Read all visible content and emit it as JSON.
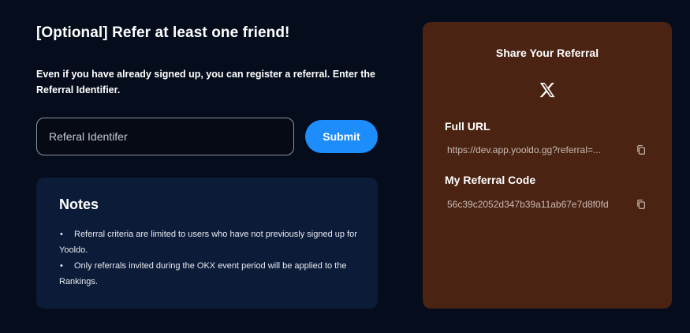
{
  "referral": {
    "title": "[Optional] Refer at least one friend!",
    "description": "Even if you have already signed up, you can register a referral.  Enter the Referral Identifier.",
    "input_placeholder": "Referal Identifer",
    "input_value": "",
    "submit_label": "Submit"
  },
  "notes": {
    "title": "Notes",
    "bullet": "•",
    "items": [
      "Referral criteria are limited to users who have not previously signed up for Yooldo.",
      "Only referrals invited during the OKX event period will be applied to the Rankings."
    ]
  },
  "share": {
    "title": "Share Your Referral",
    "x_glyph": "𝕏",
    "full_url_label": "Full URL",
    "full_url_value": "https://dev.app.yooldo.gg?referral=...",
    "code_label": "My Referral Code",
    "code_value": "56c39c2052d347b39a11ab67e7d8f0fd"
  },
  "colors": {
    "background": "#050d1c",
    "notes_panel": "#0b1b38",
    "share_panel": "#4b2312",
    "accent": "#1c8dfa"
  },
  "icons": [
    "x-logo-icon",
    "copy-url-icon",
    "copy-code-icon"
  ]
}
